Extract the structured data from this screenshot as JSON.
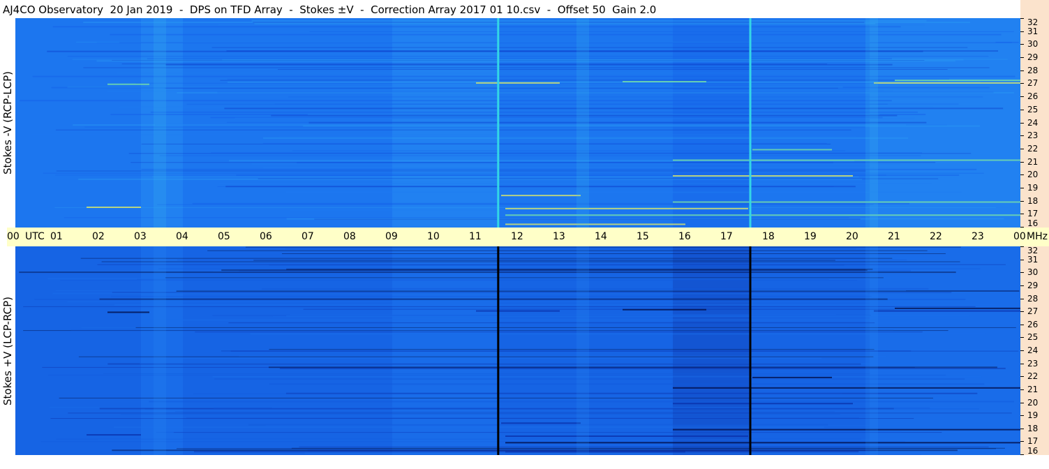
{
  "chart_data": {
    "type": "heatmap",
    "title": "AJ4CO Observatory  20 Jan 2019  -  DPS on TFD Array  -  Stokes ±V  -  Correction Array 2017 01 10.csv  -  Offset 50  Gain 2.0",
    "x_ticks": [
      "00",
      "UTC",
      "01",
      "02",
      "03",
      "04",
      "05",
      "06",
      "07",
      "08",
      "09",
      "10",
      "11",
      "12",
      "13",
      "14",
      "15",
      "16",
      "17",
      "18",
      "19",
      "20",
      "21",
      "22",
      "23",
      "00",
      "MHz"
    ],
    "x_hours_start": 0,
    "x_hours_end": 24,
    "y_ticks": [
      "32",
      "31",
      "30",
      "29",
      "28",
      "27",
      "26",
      "25",
      "24",
      "23",
      "22",
      "21",
      "20",
      "19",
      "18",
      "17",
      "16"
    ],
    "ylim": [
      16,
      32
    ],
    "panels": [
      {
        "name": "Stokes -V (RCP-LCP)",
        "ylabel": "Stokes -V (RCP-LCP)",
        "colormap": [
          "#0a3fc9",
          "#1560e8",
          "#1e7cf2",
          "#2a9af5",
          "#3fc0f0",
          "#7ee8a0",
          "#e8f060"
        ],
        "base_color": "#1c74ee",
        "gap_lines_utc": [
          11.53,
          17.55
        ],
        "gap_color": "#33d6e6"
      },
      {
        "name": "Stokes +V (LCP-RCP)",
        "ylabel": "Stokes +V (LCP-RCP)",
        "colormap": [
          "#020a40",
          "#0a2fa8",
          "#1258dc",
          "#1b6fea",
          "#2a8ff2",
          "#50c8f0",
          "#aaf0e0"
        ],
        "base_color": "#196ae8",
        "gap_lines_utc": [
          11.53,
          17.55
        ],
        "gap_color": "#000000"
      }
    ]
  },
  "colors": {
    "side_band": "#fbe3cc",
    "time_bar": "#ffffc8"
  }
}
